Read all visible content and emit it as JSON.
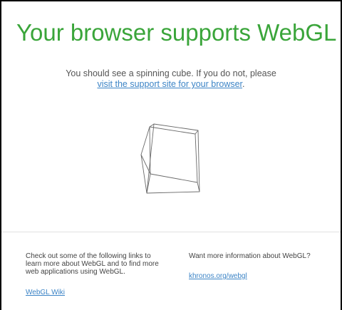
{
  "header": {
    "title": "Your browser supports WebGL"
  },
  "message": {
    "line1": "You should see a spinning cube. If you do not, please",
    "link_text": "visit the support site for your browser",
    "after_link": "."
  },
  "footer": {
    "left_text": "Check out some of the following links to learn more about WebGL and to find more web applications using WebGL.",
    "left_link": "WebGL Wiki",
    "right_text": "Want more information about WebGL?",
    "right_link": "khronos.org/webgl"
  },
  "colors": {
    "title": "#3aa53a",
    "link": "#3c84c6",
    "text": "#555555"
  },
  "icons": [
    "spinning-cube-icon"
  ]
}
